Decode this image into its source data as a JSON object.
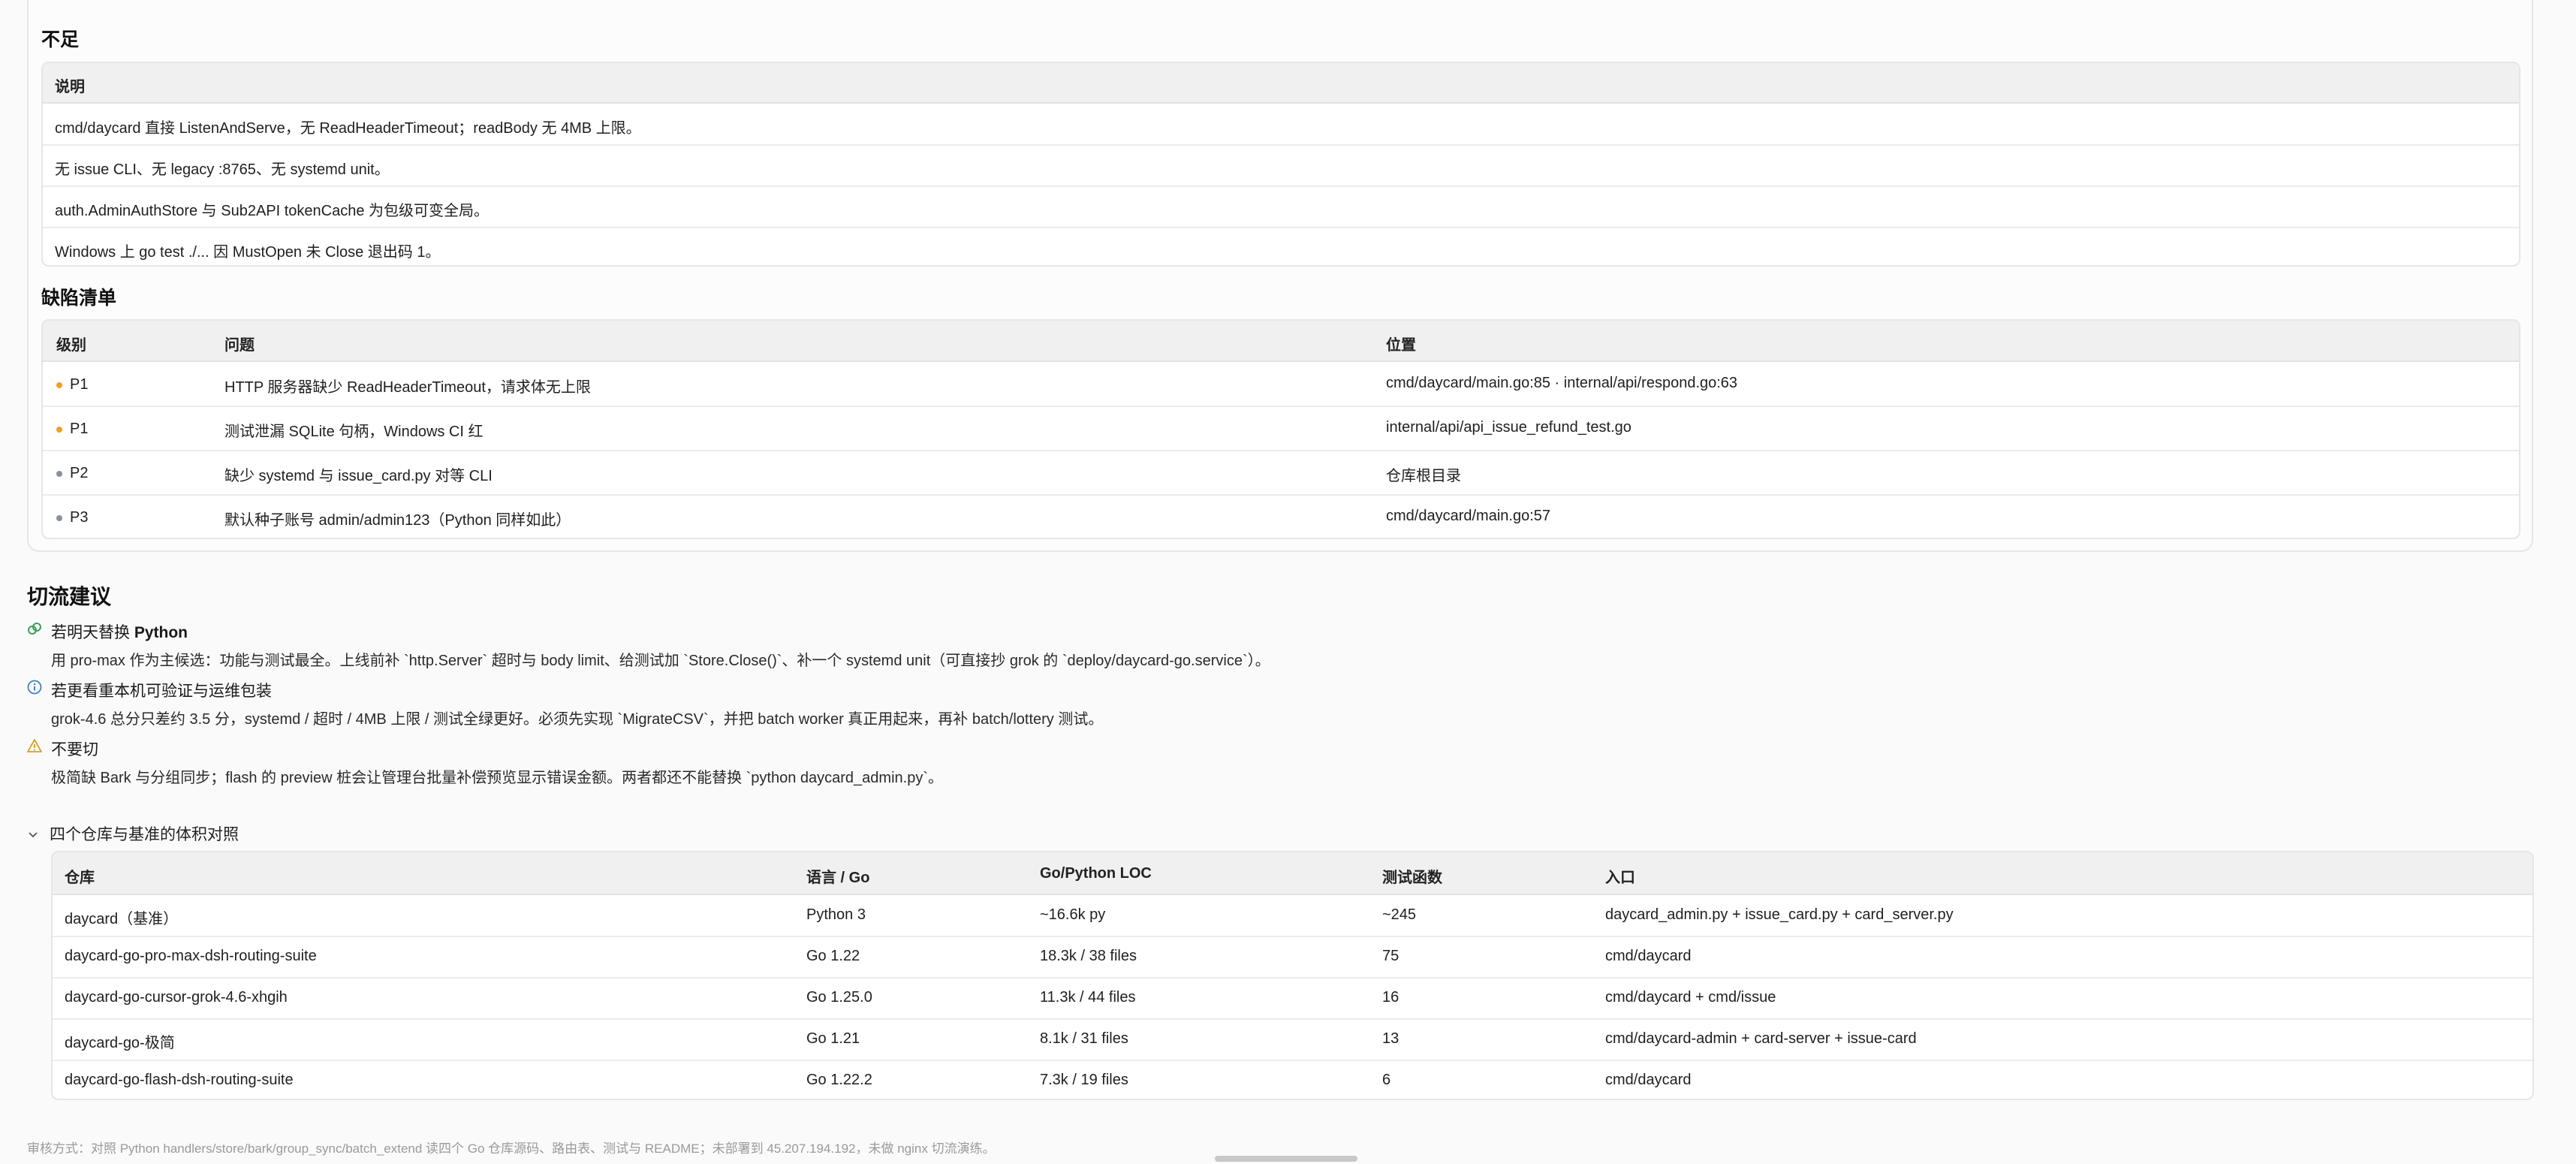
{
  "shortcomings": {
    "title": "不足",
    "header": "说明",
    "rows": [
      "cmd/daycard 直接 ListenAndServe，无 ReadHeaderTimeout；readBody 无 4MB 上限。",
      "无 issue CLI、无 legacy :8765、无 systemd unit。",
      "auth.AdminAuthStore 与 Sub2API tokenCache 为包级可变全局。",
      "Windows 上 go test ./... 因 MustOpen 未 Close 退出码 1。"
    ]
  },
  "defects": {
    "title": "缺陷清单",
    "headers": [
      "级别",
      "问题",
      "位置"
    ],
    "rows": [
      {
        "level": "P1",
        "level_color": "#f0a020",
        "issue": "HTTP 服务器缺少 ReadHeaderTimeout，请求体无上限",
        "location": "cmd/daycard/main.go:85 · internal/api/respond.go:63"
      },
      {
        "level": "P1",
        "level_color": "#f0a020",
        "issue": "测试泄漏 SQLite 句柄，Windows CI 红",
        "location": "internal/api/api_issue_refund_test.go"
      },
      {
        "level": "P2",
        "level_color": "#8a8fa0",
        "issue": "缺少 systemd 与 issue_card.py 对等 CLI",
        "location": "仓库根目录"
      },
      {
        "level": "P3",
        "level_color": "#8a8fa0",
        "issue": "默认种子账号 admin/admin123（Python 同样如此）",
        "location": "cmd/daycard/main.go:57"
      }
    ]
  },
  "recommendations": {
    "title": "切流建议",
    "items": [
      {
        "icon": "link-check-icon",
        "icon_color": "#3aa05a",
        "title_prefix": "若明天替换 ",
        "title_bold": "Python",
        "desc": "用 pro-max 作为主候选：功能与测试最全。上线前补 `http.Server` 超时与 body limit、给测试加 `Store.Close()`、补一个 systemd unit（可直接抄 grok 的 `deploy/daycard-go.service`）。"
      },
      {
        "icon": "info-icon",
        "icon_color": "#3b82c4",
        "title_prefix": "若更看重本机可验证与运维包装",
        "title_bold": "",
        "desc": "grok-4.6 总分只差约 3.5 分，systemd / 超时 / 4MB 上限 / 测试全绿更好。必须先实现 `MigrateCSV`，并把 batch worker 真正用起来，再补 batch/lottery 测试。"
      },
      {
        "icon": "warning-icon",
        "icon_color": "#e0a020",
        "title_prefix": "不要切",
        "title_bold": "",
        "desc": "极简缺 Bark 与分组同步；flash 的 preview 桩会让管理台批量补偿预览显示错误金额。两者都还不能替换 `python daycard_admin.py`。"
      }
    ]
  },
  "comparison": {
    "toggle_label": "四个仓库与基准的体积对照",
    "headers": [
      "仓库",
      "语言 / Go",
      "Go/Python LOC",
      "测试函数",
      "入口"
    ],
    "rows": [
      [
        "daycard（基准）",
        "Python 3",
        "~16.6k py",
        "~245",
        "daycard_admin.py + issue_card.py + card_server.py"
      ],
      [
        "daycard-go-pro-max-dsh-routing-suite",
        "Go 1.22",
        "18.3k / 38 files",
        "75",
        "cmd/daycard"
      ],
      [
        "daycard-go-cursor-grok-4.6-xhgih",
        "Go 1.25.0",
        "11.3k / 44 files",
        "16",
        "cmd/daycard + cmd/issue"
      ],
      [
        "daycard-go-极简",
        "Go 1.21",
        "8.1k / 31 files",
        "13",
        "cmd/daycard-admin + card-server + issue-card"
      ],
      [
        "daycard-go-flash-dsh-routing-suite",
        "Go 1.22.2",
        "7.3k / 19 files",
        "6",
        "cmd/daycard"
      ]
    ]
  },
  "footer": "审核方式：对照 Python handlers/store/bark/group_sync/batch_extend 读四个 Go 仓库源码、路由表、测试与 README；未部署到 45.207.194.192，未做 nginx 切流演练。"
}
